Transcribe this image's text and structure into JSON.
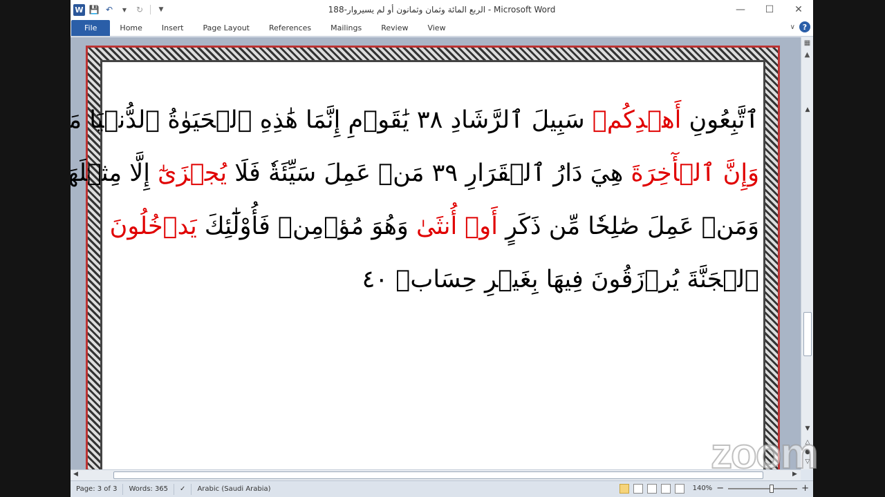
{
  "window": {
    "title": "الربع المائة وثمان وثمانون أو لم يسيروار-188 - Microsoft Word",
    "app_logo": "W"
  },
  "qat": {
    "icons": [
      "word-logo-icon",
      "save-icon",
      "undo-icon",
      "redo-icon",
      "customize-icon"
    ]
  },
  "ribbon": {
    "tabs": [
      "File",
      "Home",
      "Insert",
      "Page Layout",
      "References",
      "Mailings",
      "Review",
      "View"
    ],
    "active_tab": "File",
    "accent_color": "#2a5ea8"
  },
  "document": {
    "lines": [
      [
        {
          "t": "ٱتَّبِعُونِ ",
          "c": "black"
        },
        {
          "t": "أَهۡدِكُمۡ",
          "c": "red"
        },
        {
          "t": " سَبِيلَ ٱلرَّشَادِ ٣٨ يَٰقَوۡمِ إِنَّمَا هَٰذِهِ ٱلۡحَيَوٰةُ ٱلدُّنۡيَا ",
          "c": "black"
        },
        {
          "t": "مَتَٰعٌ",
          "c": "black"
        }
      ],
      [
        {
          "t": "وَإِنَّ ",
          "c": "red"
        },
        {
          "t": "ٱلۡأٓخِرَةَ",
          "c": "red"
        },
        {
          "t": " هِيَ دَارُ ٱلۡقَرَارِ ٣٩ مَنۡ عَمِلَ سَيِّئَةٗ فَلَا ",
          "c": "black"
        },
        {
          "t": "يُجۡزَىٰٓ",
          "c": "red"
        },
        {
          "t": " إِلَّا مِثۡلَهَاۖ",
          "c": "black"
        }
      ],
      [
        {
          "t": "وَمَنۡ عَمِلَ صَٰلِحٗا مِّن ذَكَرٍ ",
          "c": "black"
        },
        {
          "t": "أَوۡ أُنثَىٰ",
          "c": "red"
        },
        {
          "t": " وَهُوَ ",
          "c": "black"
        },
        {
          "t": "مُؤۡمِنٞ",
          "c": "black"
        },
        {
          "t": " فَأُوْلَٰٓئِكَ ",
          "c": "black"
        },
        {
          "t": "يَدۡخُلُونَ",
          "c": "red"
        }
      ],
      [
        {
          "t": "ٱلۡجَنَّةَ يُرۡزَقُونَ فِيهَا بِغَيۡرِ حِسَابٖ ٤٠",
          "c": "black"
        }
      ]
    ]
  },
  "status": {
    "page": "Page: 3 of 3",
    "words": "Words: 365",
    "language": "Arabic (Saudi Arabia)",
    "zoom": "140%",
    "zoom_minus": "−",
    "zoom_plus": "+"
  },
  "watermark": "zoom"
}
